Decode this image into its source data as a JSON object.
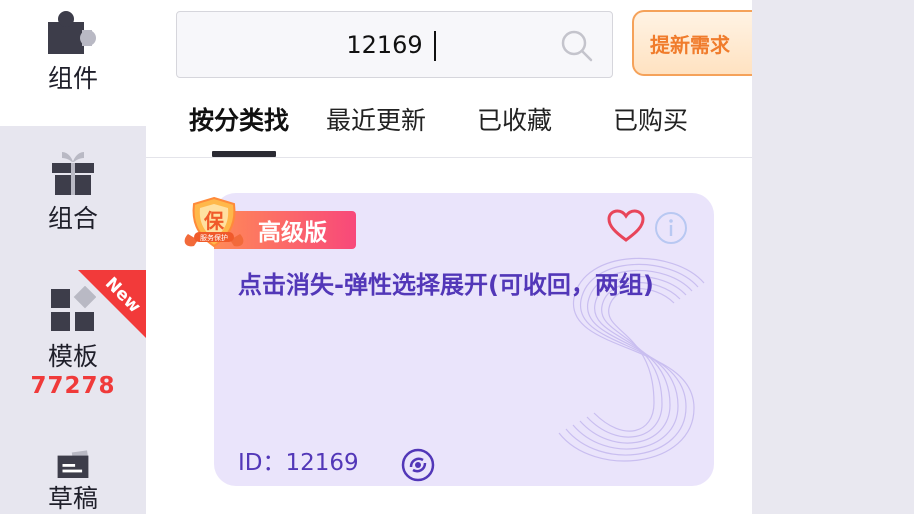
{
  "sidebar": {
    "items": [
      {
        "label": "组件",
        "icon": "puzzle-icon",
        "active": true
      },
      {
        "label": "组合",
        "icon": "gift-icon",
        "active": false
      },
      {
        "label": "模板",
        "icon": "template-grid-icon",
        "active": false,
        "badge": "New",
        "count": "77278"
      },
      {
        "label": "草稿",
        "icon": "draft-folder-icon",
        "active": false
      }
    ]
  },
  "search": {
    "value": "12169",
    "placeholder": ""
  },
  "submit_button": {
    "label": "提新需求"
  },
  "tabs": [
    {
      "label": "按分类找",
      "active": true
    },
    {
      "label": "最近更新",
      "active": false
    },
    {
      "label": "已收藏",
      "active": false
    },
    {
      "label": "已购买",
      "active": false
    }
  ],
  "card": {
    "tier": "高级版",
    "title": "点击消失-弹性选择展开(可收回，两组)",
    "id_label": "ID：12169",
    "seal_text": "保",
    "seal_subtext": "服务保护"
  },
  "colors": {
    "accent_purple": "#5237b8",
    "card_bg": "#eae4fb",
    "badge_red": "#f03a3a",
    "orange": "#f07c2c"
  }
}
